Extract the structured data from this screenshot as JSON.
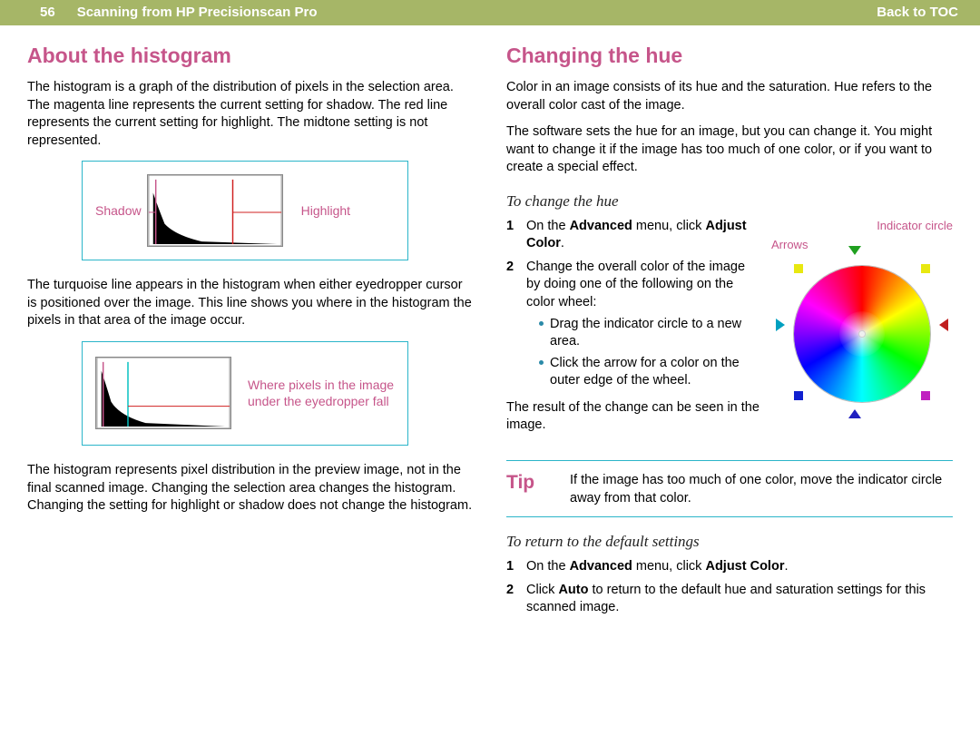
{
  "header": {
    "page_number": "56",
    "title": "Scanning from HP Precisionscan Pro",
    "back_link": "Back to TOC"
  },
  "left": {
    "heading": "About the histogram",
    "p1": "The histogram is a graph of the distribution of pixels in the selection area. The magenta line represents the current setting for shadow. The red line represents the current setting for highlight. The midtone setting is not represented.",
    "fig1": {
      "shadow": "Shadow",
      "highlight": "Highlight"
    },
    "p2": "The turquoise line appears in the histogram when either eyedropper cursor is positioned over the image. This line shows you where in the histogram the pixels in that area of the image occur.",
    "fig2_caption": "Where pixels in the image under the eyedropper fall",
    "p3": "The histogram represents pixel distribution in the preview image, not in the final scanned image. Changing the selection area changes the histogram. Changing the setting for highlight or shadow does not change the histogram."
  },
  "right": {
    "heading": "Changing the hue",
    "p1": "Color in an image consists of its hue and the saturation. Hue refers to the overall color cast of the image.",
    "p2": "The software sets the hue for an image, but you can change it. You might want to change it if the image has too much of one color, or if you want to create a special effect.",
    "sub1": "To change the hue",
    "step1_pre": "On the ",
    "step1_b1": "Advanced",
    "step1_mid": " menu, click ",
    "step1_b2": "Adjust Color",
    "step1_post": ".",
    "step2": "Change the overall color of the image by doing one of the following on the color wheel:",
    "bullet1": "Drag the indicator circle to a new area.",
    "bullet2": "Click the arrow for a color on the outer edge of the wheel.",
    "p3": "The result of the change can be seen in the image.",
    "wheel_labels": {
      "indicator": "Indicator circle",
      "arrows": "Arrows"
    },
    "tip": {
      "label": "Tip",
      "text": "If the image has too much of one color, move the indicator circle away from that color."
    },
    "sub2": "To return to the default settings",
    "r_step1_pre": "On the ",
    "r_step1_b1": "Advanced",
    "r_step1_mid": " menu, click ",
    "r_step1_b2": "Adjust Color",
    "r_step1_post": ".",
    "r_step2_pre": "Click ",
    "r_step2_b": "Auto",
    "r_step2_post": " to return to the default hue and saturation settings for this scanned image."
  }
}
